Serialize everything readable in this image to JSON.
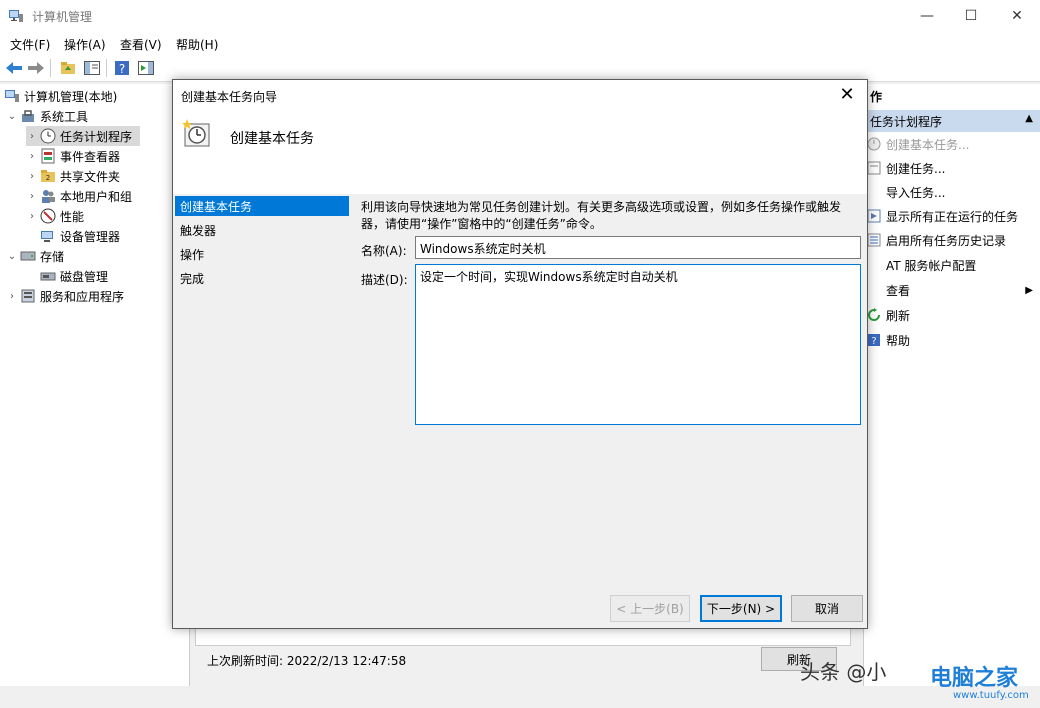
{
  "window": {
    "title": "计算机管理",
    "minimize": "—",
    "maximize": "☐",
    "close": "✕"
  },
  "menu": [
    "文件(F)",
    "操作(A)",
    "查看(V)",
    "帮助(H)"
  ],
  "tree": [
    {
      "label": "计算机管理(本地)",
      "level": 0,
      "arrow": "",
      "icon": "computer-management-icon"
    },
    {
      "label": "系统工具",
      "level": 1,
      "arrow": "⌄",
      "icon": "tools-icon"
    },
    {
      "label": "任务计划程序",
      "level": 2,
      "arrow": "›",
      "icon": "clock-icon",
      "selected": true
    },
    {
      "label": "事件查看器",
      "level": 2,
      "arrow": "›",
      "icon": "event-viewer-icon"
    },
    {
      "label": "共享文件夹",
      "level": 2,
      "arrow": "›",
      "icon": "shared-folder-icon"
    },
    {
      "label": "本地用户和组",
      "level": 2,
      "arrow": "›",
      "icon": "users-icon"
    },
    {
      "label": "性能",
      "level": 2,
      "arrow": "›",
      "icon": "performance-icon"
    },
    {
      "label": "设备管理器",
      "level": 2,
      "arrow": "",
      "icon": "device-manager-icon"
    },
    {
      "label": "存储",
      "level": 1,
      "arrow": "⌄",
      "icon": "storage-icon"
    },
    {
      "label": "磁盘管理",
      "level": 2,
      "arrow": "",
      "icon": "disk-icon"
    },
    {
      "label": "服务和应用程序",
      "level": 1,
      "arrow": "›",
      "icon": "services-icon"
    }
  ],
  "center": {
    "strip_text": "...",
    "refresh_time": "上次刷新时间: 2022/2/13 12:47:58",
    "refresh_button": "刷新"
  },
  "actions": {
    "header": "作",
    "section": "任务计划程序",
    "items": [
      {
        "label": "创建基本任务...",
        "disabled": true,
        "icon": "task-wizard-icon"
      },
      {
        "label": "创建任务...",
        "icon": "create-task-icon"
      },
      {
        "label": "导入任务...",
        "icon": ""
      },
      {
        "label": "显示所有正在运行的任务",
        "icon": "running-tasks-icon"
      },
      {
        "label": "启用所有任务历史记录",
        "icon": "history-icon"
      },
      {
        "label": "AT 服务帐户配置",
        "icon": ""
      },
      {
        "label": "查看",
        "icon": "",
        "submenu": true
      },
      {
        "label": "刷新",
        "icon": "refresh-icon"
      },
      {
        "label": "帮助",
        "icon": "help-icon"
      }
    ]
  },
  "dialog": {
    "title": "创建基本任务向导",
    "header": "创建基本任务",
    "steps": [
      "创建基本任务",
      "触发器",
      "操作",
      "完成"
    ],
    "description": "利用该向导快速地为常见任务创建计划。有关更多高级选项或设置，例如多任务操作或触发器，请使用“操作”窗格中的“创建任务”命令。",
    "name_label": "名称(A):",
    "name_value": "Windows系统定时关机",
    "desc_label": "描述(D):",
    "desc_value": "设定一个时间，实现Windows系统定时自动关机",
    "back_button": "< 上一步(B)",
    "next_button": "下一步(N) >",
    "cancel_button": "取消"
  },
  "watermark": {
    "text": "头条 @小",
    "logo": "电脑之家",
    "url": "www.tuufy.com"
  }
}
